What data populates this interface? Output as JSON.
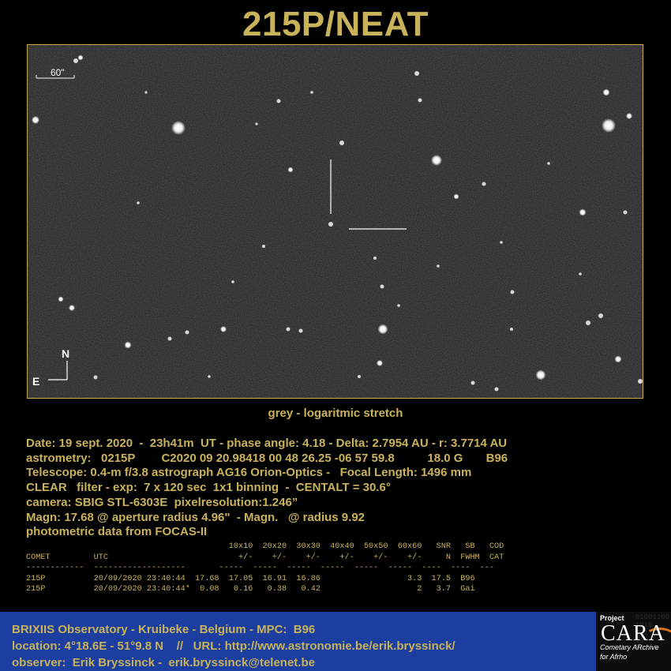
{
  "title": "215P/NEAT",
  "image": {
    "scale_label": "60\"",
    "north_label": "N",
    "east_label": "E",
    "border_color": "#c9a84a"
  },
  "caption": "grey -  logaritmic stretch",
  "info_lines": [
    "Date: 19 sept. 2020  -  23h41m  UT - phase angle: 4.18 - Delta: 2.7954 AU - r: 3.7714 AU",
    "astrometry:   0215P        C2020 09 20.98418 00 48 26.25 -06 57 59.8          18.0 G       B96",
    "Telescope: 0.4-m f/3.8 astrograph AG16 Orion-Optics -   Focal Length: 1496 mm",
    "CLEAR   filter - exp:  7 x 120 sec  1x1 binning  -  CENTALT = 30.6°",
    "camera: SBIG STL-6303E  pixelresolution:1.246”",
    "Magn: 17.68 @ aperture radius 4.96\"  - Magn.   @ radius 9.92",
    "photometric data from FOCAS-II"
  ],
  "photometry_lines": [
    "                                          10x10  20x20  30x30  40x40  50x50  60x60   SNR   SB   COD",
    "COMET         UTC                           +/-    +/-    +/-    +/-    +/-    +/-     N  FWHM  CAT",
    "------------  -------------------       -----  -----  -----  -----  -----  -----  ----  ----  ---",
    "215P          20/09/2020 23:40:44  17.68  17.05  16.91  16.86                  3.3  17.5  B96",
    "215P          20/09/2020 23:40:44*  0.08   0.16   0.38   0.42                    2   3.7  Gai"
  ],
  "footer_lines": [
    "BRIXIIS Observatory - Kruibeke - Belgium - MPC:  B96",
    "location: 4°18.6E - 51°9.8 N    //   URL: http://www.astronomie.be/erik.bryssinck/",
    "observer:  Erik Bryssinck -  erik.bryssinck@telenet.be"
  ],
  "logo": {
    "project": "Project",
    "name": "CARA",
    "sub1": "Cometary ARchive",
    "sub2": "for Afrho",
    "bits": "01001100\n1010\n011\n10\n011"
  },
  "colors": {
    "text": "#c8b25a",
    "footer_bg": "#1b3ea0",
    "background": "#000000"
  }
}
